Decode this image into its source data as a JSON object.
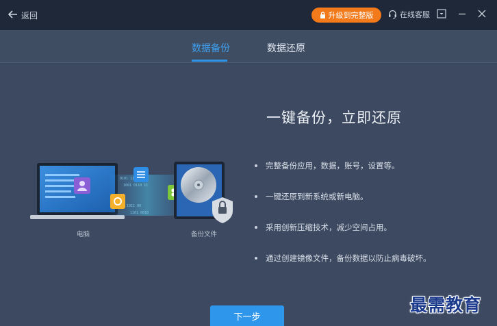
{
  "titlebar": {
    "back_label": "返回",
    "upgrade_label": "升级到完整版",
    "service_label": "在线客服"
  },
  "tabs": [
    {
      "label": "数据备份",
      "active": true
    },
    {
      "label": "数据还原",
      "active": false
    }
  ],
  "main": {
    "headline": "一键备份，立即还原",
    "features": [
      "完整备份应用，数据，账号，设置等。",
      "一键还原到新系统或新电脑。",
      "采用创新压缩技术，减少空间占用。",
      "通过创建镜像文件，备份数据以防止病毒破坏。"
    ],
    "illustration": {
      "computer_caption": "电脑",
      "backup_caption": "备份文件"
    },
    "next_button": "下一步"
  },
  "watermark": "最需教育",
  "colors": {
    "accent": "#2e97ec",
    "upgrade": "#f27a1a",
    "titlebar": "#1e2838",
    "background": "#3c4960"
  }
}
